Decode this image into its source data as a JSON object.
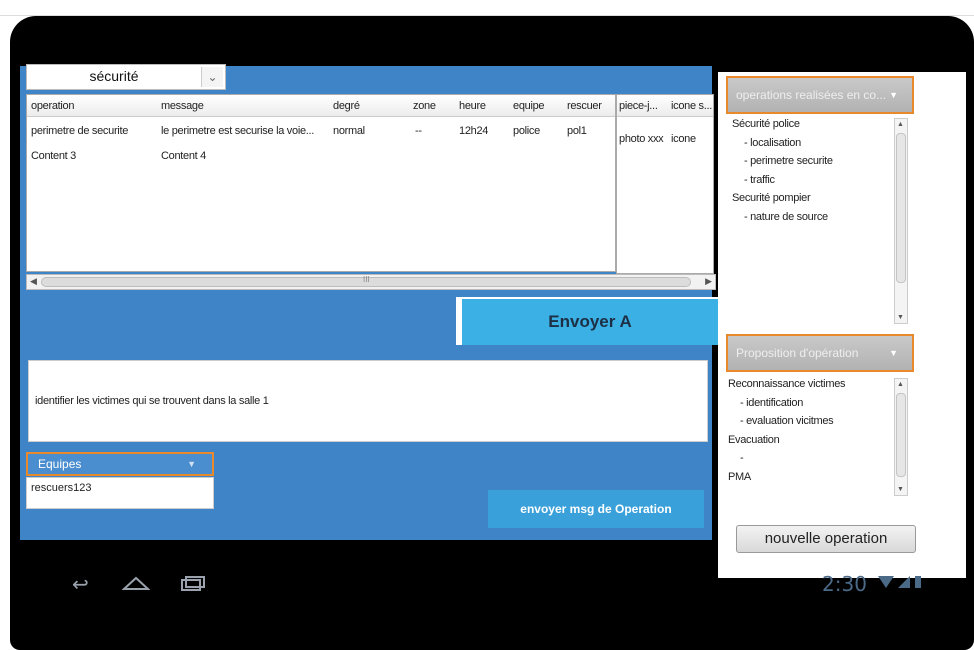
{
  "security_select": {
    "value": "sécurité",
    "arrow": "chevron-down"
  },
  "table": {
    "headers": [
      "operation",
      "message",
      "degré",
      "zone",
      "heure",
      "equipe",
      "rescuer",
      "piece-j...",
      "icone s..."
    ],
    "rows": [
      [
        "perimetre de securite",
        "le perimetre est securise la voie...",
        "normal",
        "--",
        "12h24",
        "police",
        "pol1",
        "photo xxx",
        "icone"
      ],
      [
        "Content 3",
        "Content 4",
        "",
        "",
        "",
        "",
        "",
        "",
        ""
      ]
    ],
    "scroll_grip": "III"
  },
  "send_a_label": "Envoyer A",
  "message_text": "identifier les victimes qui se trouvent dans la salle 1",
  "equipes": {
    "label": "Equipes",
    "items": [
      "rescuers123"
    ]
  },
  "send_op_label": "envoyer msg de Operation",
  "ops_panel": {
    "select_label": "operations realisées en co...",
    "tree": [
      "Sécurité police",
      "- localisation",
      "- perimetre securite",
      "- traffic",
      "Securité pompier",
      "- nature de source"
    ]
  },
  "proposals_panel": {
    "select_label": "Proposition d'opération",
    "tree": [
      "Reconnaissance victimes",
      "- identification",
      "- evaluation vicitmes",
      "Evacuation",
      "-",
      "PMA"
    ]
  },
  "new_op_label": "nouvelle operation",
  "nav": {
    "back": "back-icon",
    "home": "home-icon",
    "recent": "recent-apps-icon"
  },
  "status": {
    "time": "2:30"
  },
  "colors": {
    "panel_blue": "#3f84c6",
    "button_blue": "#3ab0e4",
    "accent_orange": "#e88a2c"
  }
}
